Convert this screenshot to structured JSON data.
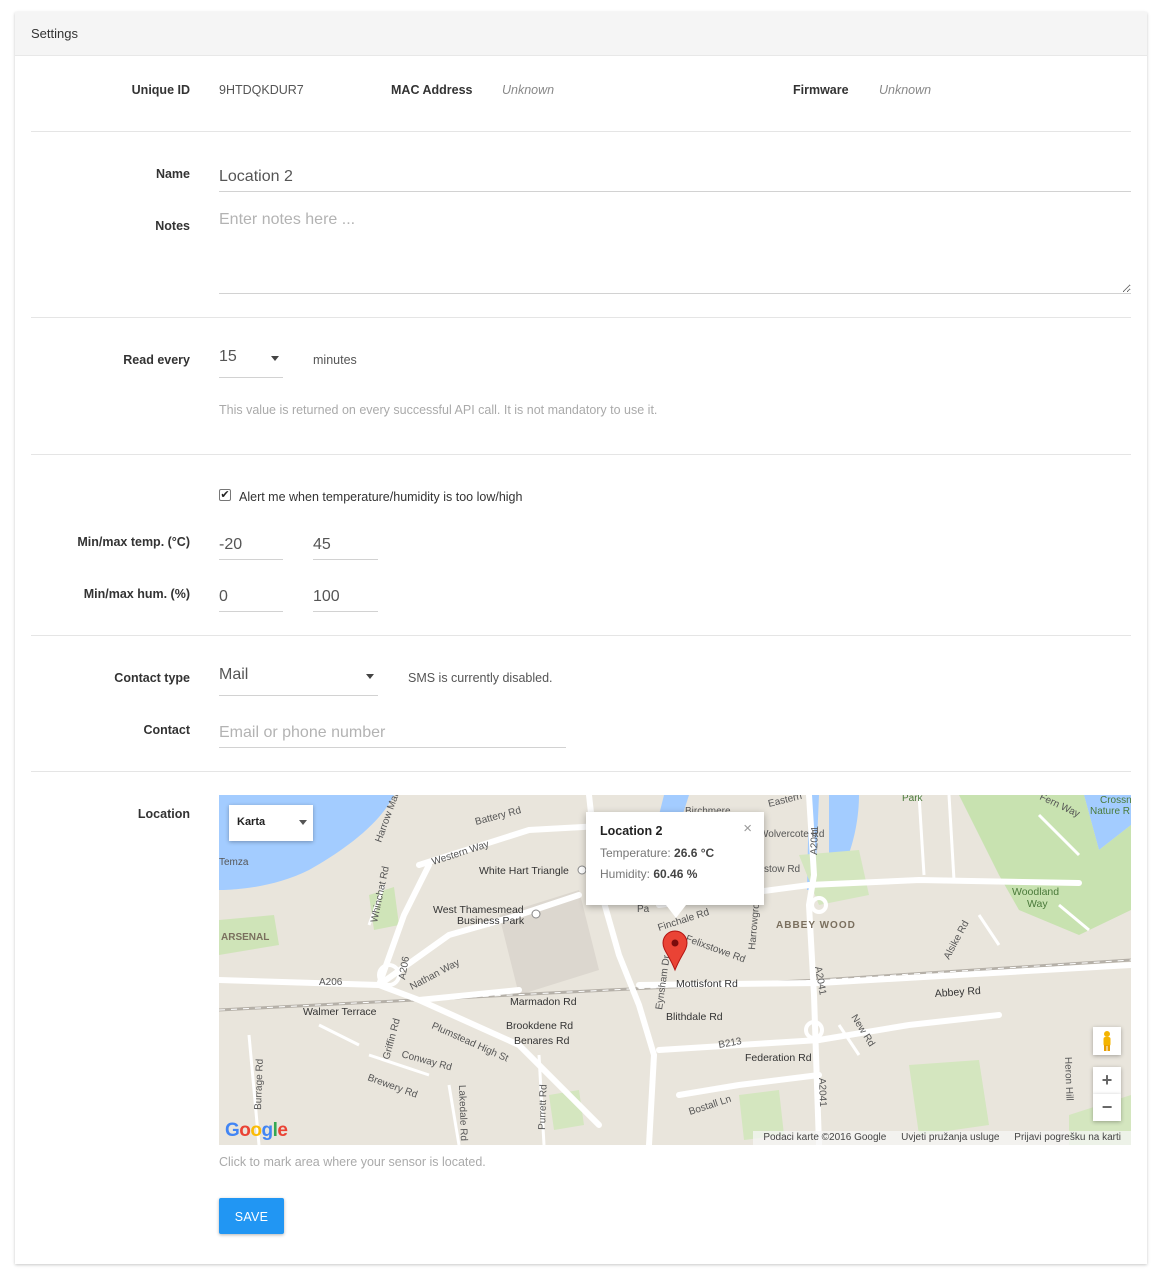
{
  "panel": {
    "title": "Settings"
  },
  "device": {
    "unique_id_label": "Unique ID",
    "unique_id": "9HTDQKDUR7",
    "mac_label": "MAC Address",
    "mac": "Unknown",
    "firmware_label": "Firmware",
    "firmware": "Unknown"
  },
  "general": {
    "name_label": "Name",
    "name_value": "Location 2",
    "notes_label": "Notes",
    "notes_placeholder": "Enter notes here ..."
  },
  "reading": {
    "label": "Read every",
    "value": "15",
    "unit": "minutes",
    "hint": "This value is returned on every successful API call. It is not mandatory to use it."
  },
  "alerts": {
    "checkbox_label": "Alert me when temperature/humidity is too low/high",
    "checked": true,
    "temp_label": "Min/max temp. (°C)",
    "temp_min": "-20",
    "temp_max": "45",
    "hum_label": "Min/max hum. (%)",
    "hum_min": "0",
    "hum_max": "100"
  },
  "contact": {
    "type_label": "Contact type",
    "type_value": "Mail",
    "sms_note": "SMS is currently disabled.",
    "contact_label": "Contact",
    "contact_placeholder": "Email or phone number"
  },
  "location": {
    "label": "Location",
    "map_type": "Karta",
    "info_title": "Location 2",
    "temp_label": "Temperature:",
    "temp_value": "26.6 °C",
    "hum_label": "Humidity:",
    "hum_value": "60.46 %",
    "close_glyph": "×",
    "zoom_in": "+",
    "zoom_out": "−",
    "logo": "Google",
    "footer": [
      "Podaci karte ©2016 Google",
      "Uvjeti pružanja usluge",
      "Prijavi pogrešku na karti"
    ],
    "labels": {
      "temza": "Temza",
      "arsenal": "ARSENAL",
      "white_hart": "White Hart Triangle",
      "west_thamesmead": "West Thamesmead",
      "business_park": "Business Park",
      "western_way": "Western Way",
      "battery_rd": "Battery Rd",
      "harrow": "Harrow Manorway",
      "whinchat": "Whinchat Rd",
      "nathan_way": "Nathan Way",
      "a206": "A206",
      "a206b": "A206",
      "walmer": "Walmer Terrace",
      "griffin": "Griffin Rd",
      "conway": "Conway Rd",
      "plumstead": "Plumstead High St",
      "brewery": "Brewery Rd",
      "burrage": "Burrage Rd",
      "lakedale": "Lakedale Rd",
      "purrett": "Purrett Rd",
      "marmadon": "Marmadon Rd",
      "brookdene": "Brookdene Rd",
      "benares": "Benares Rd",
      "eynsham": "Eynsham Dr",
      "mottisfont": "Mottisfont Rd",
      "felixstowe": "Felixstowe Rd",
      "finchale": "Finchale Rd",
      "blithdale": "Blithdale Rd",
      "b213": "B213",
      "federation": "Federation Rd",
      "bostall": "Bostall Ln",
      "abbey_wood": "ABBEY WOOD",
      "abbey_rd": "Abbey Rd",
      "a2041": "A2041",
      "a2041b": "A2041",
      "a2041c": "A2041",
      "new_rd": "New Rd",
      "alsike": "Alsike Rd",
      "woodland": "Woodland",
      "woodland_way": "Way",
      "birchmere": "Birchmere",
      "eastern": "Eastern",
      "wolvercote": "Wolvercote Rd",
      "harrowgrove": "Harrowgrove Rd",
      "heron": "Heron Hill",
      "crossness": "Crossness",
      "nature": "Nature R",
      "park": "Park",
      "fern_way": "Fern Way",
      "tow_rd": "stow Rd",
      "pa": "Pa"
    },
    "hint": "Click to mark area where your sensor is located."
  },
  "actions": {
    "save": "SAVE"
  }
}
